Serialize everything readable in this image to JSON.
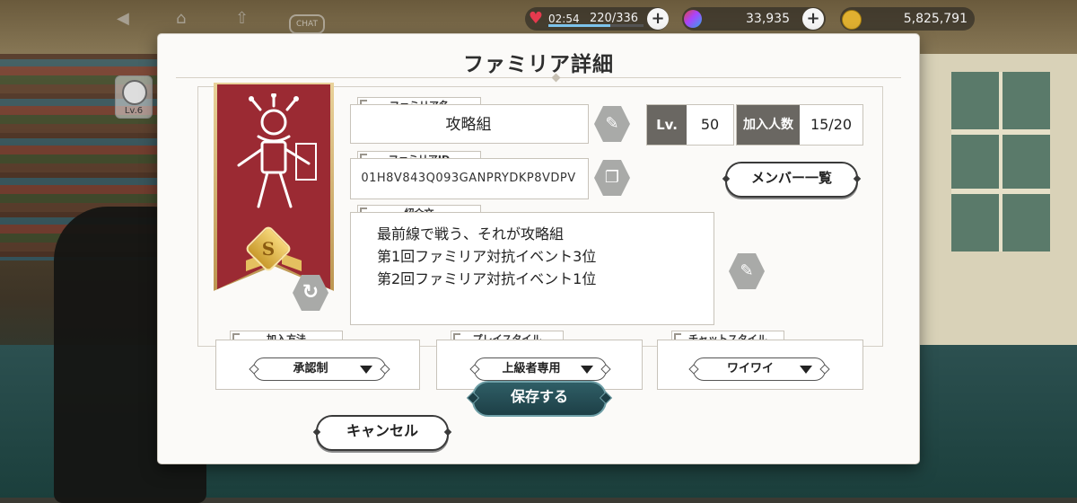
{
  "topbar": {
    "chat_label": "CHAT",
    "stamina_timer": "02:54",
    "stamina_value": "220/336",
    "stamina_fraction": 0.655,
    "gems": "33,935",
    "coins": "5,825,791",
    "plus": "+"
  },
  "level_badge": "Lv.6",
  "modal": {
    "title": "ファミリア詳細",
    "name_label": "ファミリア名",
    "name_value": "攻略組",
    "id_label": "ファミリアID",
    "id_value": "01H8V843Q093GANPRYDKP8VDPV",
    "intro_label": "紹介文",
    "intro_lines": [
      "最前線で戦う、それが攻略組",
      "第1回ファミリア対抗イベント3位",
      "第2回ファミリア対抗イベント1位"
    ],
    "lv_label": "Lv.",
    "lv_value": "50",
    "members_label": "加入人数",
    "members_value": "15/20",
    "member_list_button": "メンバー一覧",
    "rank_letter": "S",
    "join_method_label": "加入方法",
    "join_method_value": "承認制",
    "play_style_label": "プレイスタイル",
    "play_style_value": "上級者専用",
    "chat_style_label": "チャットスタイル",
    "chat_style_value": "ワイワイ",
    "cancel_button": "キャンセル",
    "save_button": "保存する"
  },
  "icons": [
    "back-icon",
    "home-icon",
    "upload-icon",
    "heart-icon",
    "gem-icon",
    "coin-icon",
    "edit-icon",
    "copy-icon",
    "refresh-icon",
    "dropdown-caret-icon"
  ],
  "colors": {
    "banner": "#9b2a33",
    "label_fill": "#6a6762",
    "save_button": "#2f5e66",
    "gold": "#e0b030"
  }
}
